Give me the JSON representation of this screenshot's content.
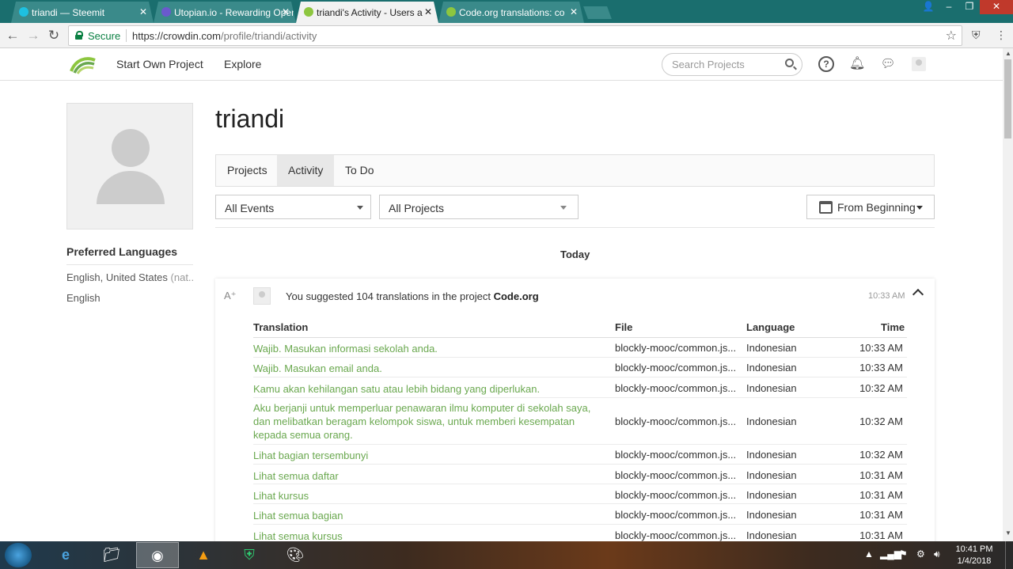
{
  "browser": {
    "tabs": [
      {
        "title": "triandi — Steemit",
        "favicon": "steemit-icon"
      },
      {
        "title": "Utopian.io - Rewarding Open",
        "favicon": "utopian-icon"
      },
      {
        "title": "triandi's Activity - Users a",
        "favicon": "crowdin-icon"
      },
      {
        "title": "Code.org translations: co",
        "favicon": "crowdin-icon"
      }
    ],
    "secure_label": "Secure",
    "url_host": "https://crowdin.com",
    "url_path": "/profile/triandi/activity"
  },
  "site_header": {
    "nav": [
      "Start Own Project",
      "Explore"
    ],
    "search_placeholder": "Search Projects",
    "help_glyph": "?"
  },
  "profile": {
    "username": "triandi",
    "preferred_title": "Preferred Languages",
    "languages": [
      {
        "name": "English, United States",
        "note": "(nat..."
      },
      {
        "name": "English",
        "note": ""
      }
    ]
  },
  "page_tabs": [
    "Projects",
    "Activity",
    "To Do"
  ],
  "filters": {
    "events": "All Events",
    "projects": "All Projects",
    "date": "From Beginning"
  },
  "activity": {
    "day_label": "Today",
    "event": {
      "text_prefix": "You suggested 104 translations in the project ",
      "project": "Code.org",
      "time": "10:33 AM"
    },
    "columns": [
      "Translation",
      "File",
      "Language",
      "Time"
    ],
    "rows": [
      {
        "translation": "Wajib. Masukan informasi sekolah anda.",
        "file": "blockly-mooc/common.js...",
        "language": "Indonesian",
        "time": "10:33 AM"
      },
      {
        "translation": "Wajib. Masukan email anda.",
        "file": "blockly-mooc/common.js...",
        "language": "Indonesian",
        "time": "10:33 AM"
      },
      {
        "translation": "Kamu akan kehilangan satu atau lebih bidang yang diperlukan.",
        "file": "blockly-mooc/common.js...",
        "language": "Indonesian",
        "time": "10:32 AM"
      },
      {
        "translation": "Aku berjanji untuk memperluar penawaran ilmu komputer di sekolah saya, dan melibatkan beragam kelompok siswa, untuk memberi kesempatan kepada semua orang.",
        "file": "blockly-mooc/common.js...",
        "language": "Indonesian",
        "time": "10:32 AM"
      },
      {
        "translation": "Lihat bagian tersembunyi",
        "file": "blockly-mooc/common.js...",
        "language": "Indonesian",
        "time": "10:32 AM"
      },
      {
        "translation": "Lihat semua daftar",
        "file": "blockly-mooc/common.js...",
        "language": "Indonesian",
        "time": "10:31 AM"
      },
      {
        "translation": "Lihat kursus",
        "file": "blockly-mooc/common.js...",
        "language": "Indonesian",
        "time": "10:31 AM"
      },
      {
        "translation": "Lihat semua bagian",
        "file": "blockly-mooc/common.js...",
        "language": "Indonesian",
        "time": "10:31 AM"
      },
      {
        "translation": "Lihat semua kursus",
        "file": "blockly-mooc/common.js...",
        "language": "Indonesian",
        "time": "10:31 AM"
      }
    ]
  },
  "taskbar": {
    "time": "10:41 PM",
    "date": "1/4/2018"
  },
  "colors": {
    "accent_green": "#6aa84f",
    "tab_strip": "#1a6e6e",
    "secure_green": "#0b8043"
  }
}
